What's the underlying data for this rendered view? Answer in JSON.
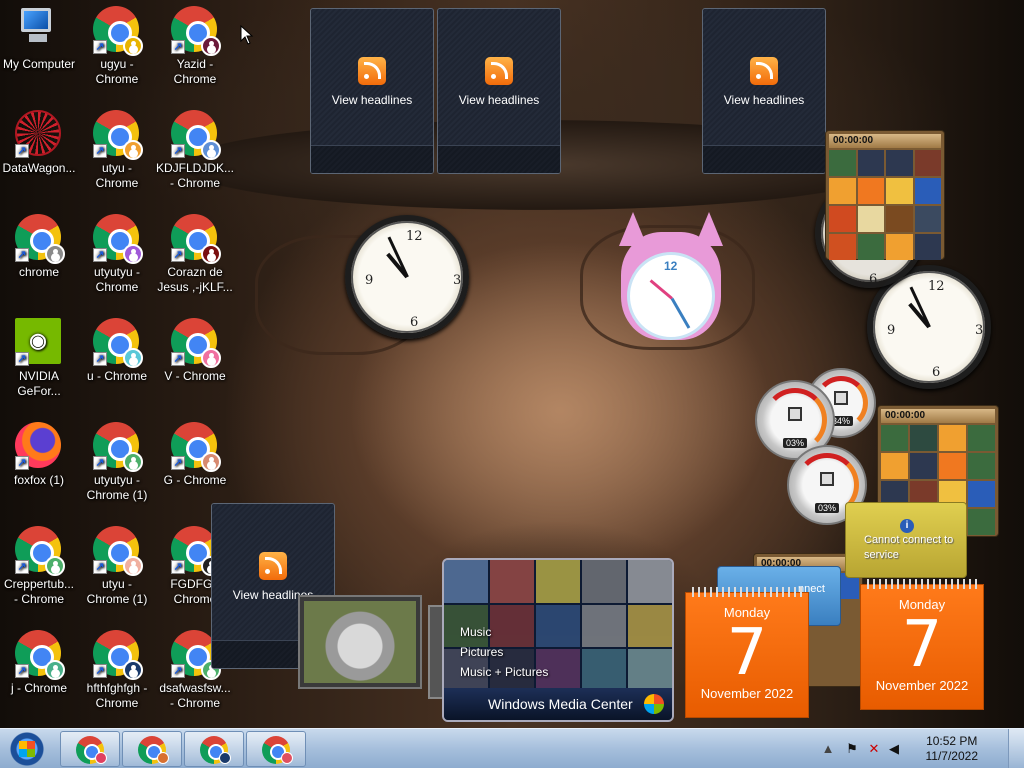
{
  "desktop_icons": [
    {
      "label": "My Computer",
      "type": "computer"
    },
    {
      "label": "ugyu -\nChrome",
      "type": "chrome",
      "badge": "#e8b400"
    },
    {
      "label": "Yazid -\nChrome",
      "type": "chrome",
      "badge": "#6b1a3a"
    },
    {
      "label": "DataWagon...",
      "type": "datawagon"
    },
    {
      "label": "utyu -\nChrome",
      "type": "chrome",
      "badge": "#f0a030"
    },
    {
      "label": "KDJFLDJDK...\n- Chrome",
      "type": "chrome",
      "badge": "#5e8fd6"
    },
    {
      "label": "chrome",
      "type": "chrome",
      "badge": "#8a8a8a"
    },
    {
      "label": "utyutyu -\nChrome",
      "type": "chrome",
      "badge": "#a05ad8"
    },
    {
      "label": "Corazn de\nJesus ,-jKLF...",
      "type": "chrome",
      "badge": "#7a1010"
    },
    {
      "label": "NVIDIA\nGeFor...",
      "type": "nvidia"
    },
    {
      "label": "u - Chrome",
      "type": "chrome",
      "badge": "#5ac8d8"
    },
    {
      "label": "V - Chrome",
      "type": "chrome",
      "badge": "#f070a0"
    },
    {
      "label": "foxfox (1)",
      "type": "firefox"
    },
    {
      "label": "utyutyu -\nChrome (1)",
      "type": "chrome",
      "badge": "#4caf6a"
    },
    {
      "label": "G - Chrome",
      "type": "chrome",
      "badge": "#d88a70"
    },
    {
      "label": "Creppertub...\n- Chrome",
      "type": "chrome",
      "badge": "#4caf6a"
    },
    {
      "label": "utyu -\nChrome (1)",
      "type": "chrome",
      "badge": "#f0b0a0"
    },
    {
      "label": "FGDFG -\nChrome",
      "type": "chrome",
      "badge": "#222222"
    },
    {
      "label": "j - Chrome",
      "type": "chrome",
      "badge": "#4ab08a"
    },
    {
      "label": "hfthfghfgh -\nChrome",
      "type": "chrome",
      "badge": "#1a3a6b"
    },
    {
      "label": "dsafwasfsw...\n- Chrome",
      "type": "chrome",
      "badge": "#4caf6a"
    }
  ],
  "feeds": [
    {
      "label": "View headlines"
    },
    {
      "label": "View headlines"
    },
    {
      "label": "View headlines"
    },
    {
      "label": "View headlines"
    }
  ],
  "puzzles": [
    {
      "timer": "00:00:00"
    },
    {
      "timer": "00:00:00"
    },
    {
      "timer": "00:00:00"
    }
  ],
  "meters": [
    {
      "value": "03%"
    },
    {
      "value": "34%"
    },
    {
      "value": "03%"
    }
  ],
  "calendars": [
    {
      "day": "Monday",
      "date": "7",
      "month_year": "November 2022"
    },
    {
      "day": "Monday",
      "date": "7",
      "month_year": "November 2022"
    }
  ],
  "weather": {
    "message": "Cannot connect to service",
    "overlapped_text": "nnect"
  },
  "media_center": {
    "menu": [
      "Music",
      "Pictures",
      "Music + Pictures"
    ],
    "title": "Windows Media Center"
  },
  "taskbar": {
    "buttons": [
      {
        "badge": "#e04060"
      },
      {
        "badge": "#d87030"
      },
      {
        "badge": "#1a3a6b"
      },
      {
        "badge": "#e05060"
      }
    ],
    "time": "10:52 PM",
    "date": "11/7/2022"
  }
}
